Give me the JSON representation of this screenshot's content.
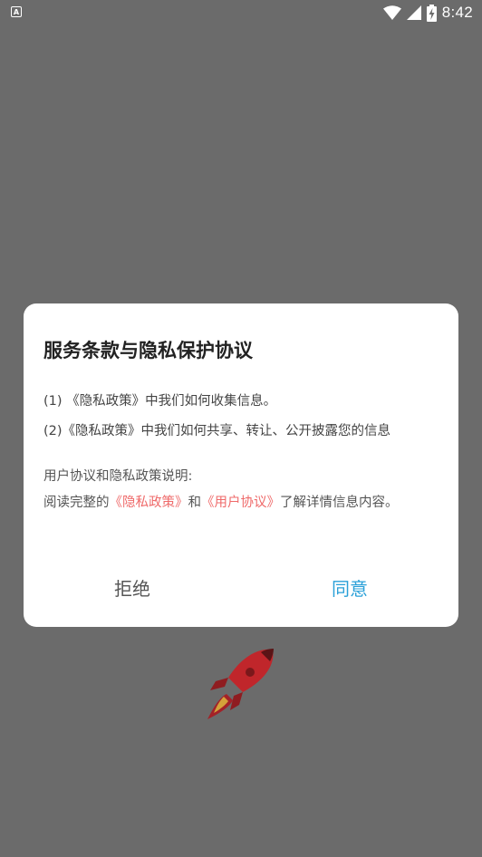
{
  "status_bar": {
    "app_icon_letter": "A",
    "time": "8:42"
  },
  "dialog": {
    "title": "服务条款与隐私保护协议",
    "items": [
      "(1) 《隐私政策》中我们如何收集信息。",
      "(2)《隐私政策》中我们如何共享、转让、公开披露您的信息"
    ],
    "description_heading": "用户协议和隐私政策说明:",
    "description": {
      "prefix": "阅读完整的",
      "privacy_link": "《隐私政策》",
      "conjunction": "和",
      "user_agreement_link": "《用户协议》",
      "suffix": "了解详情信息内容。"
    },
    "reject_label": "拒绝",
    "agree_label": "同意"
  },
  "colors": {
    "overlay": "#6b6b6b",
    "dialog_background": "#ffffff",
    "link": "#ef6a6a",
    "agree": "#2aa0d8",
    "rocket": "#c0262b"
  },
  "icons": {
    "status_app": "app-notification-icon",
    "wifi": "wifi-icon",
    "signal": "cellular-signal-icon",
    "battery": "battery-charging-icon",
    "splash": "rocket-icon"
  }
}
